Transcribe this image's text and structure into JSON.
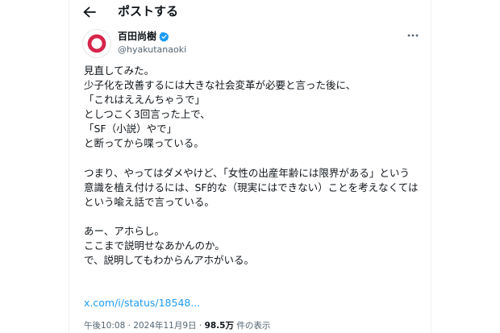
{
  "header": {
    "title": "ポストする"
  },
  "author": {
    "display_name": "百田尚樹",
    "handle": "@hyakutanaoki",
    "verified_color": "#1d9bf0",
    "avatar_ring_color": "#d6244a"
  },
  "tweet": {
    "lines": [
      "見直してみた。",
      "少子化を改善するには大きな社会変革が必要と言った後に、",
      "「これはええんちゃうで」",
      "としつこく3回言った上で、",
      "「SF（小説）やで」",
      "と断ってから喋っている。",
      "",
      "つまり、やってはダメやけど、「女性の出産年齢には限界がある」という",
      "意識を植え付けるには、SF的な（現実にはできない）ことを考えなくては",
      "という喩え話で言っている。",
      "",
      "あー、アホらし。",
      "ここまで説明せなあかんのか。",
      "で、説明してもわからんアホがいる。"
    ],
    "link_text": "x.com/i/status/18548..."
  },
  "meta": {
    "time": "午後10:08",
    "separator": " · ",
    "date": "2024年11月9日",
    "views_count": "98.5万",
    "views_label": " 件の表示"
  },
  "icons": {
    "back": "arrow-left-icon",
    "more": "more-horizontal-icon",
    "verified": "verified-badge-icon"
  },
  "colors": {
    "text": "#0f1419",
    "secondary": "#536471",
    "link": "#1d9bf0",
    "border": "#eff3f4"
  }
}
